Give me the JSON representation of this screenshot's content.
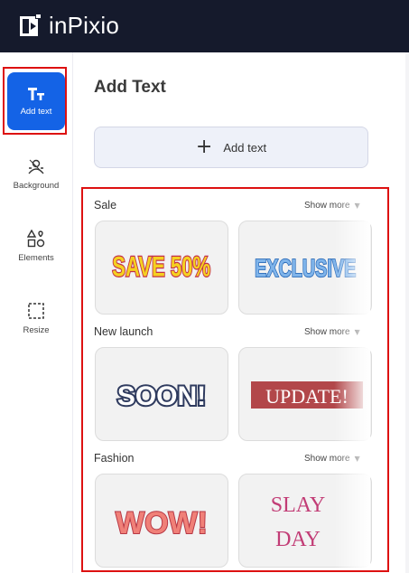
{
  "app": {
    "name": "inPixio"
  },
  "sidebar": {
    "items": [
      {
        "label": "Add text",
        "icon": "text-type-icon",
        "active": true
      },
      {
        "label": "Background",
        "icon": "background-icon",
        "active": false
      },
      {
        "label": "Elements",
        "icon": "shapes-icon",
        "active": false
      },
      {
        "label": "Resize",
        "icon": "resize-icon",
        "active": false
      }
    ]
  },
  "panel": {
    "title": "Add Text",
    "add_button_label": "Add text",
    "show_more_label": "Show more",
    "sections": [
      {
        "title": "Sale",
        "presets": [
          "SAVE 50%",
          "EXCLUSIVE"
        ]
      },
      {
        "title": "New launch",
        "presets": [
          "SOON!",
          "UPDATE!"
        ]
      },
      {
        "title": "Fashion",
        "presets": [
          "WOW!",
          "SLAY",
          "DAY"
        ]
      }
    ]
  },
  "colors": {
    "topbar": "#151a2c",
    "active": "#1463e6",
    "highlight": "#dd1111"
  }
}
